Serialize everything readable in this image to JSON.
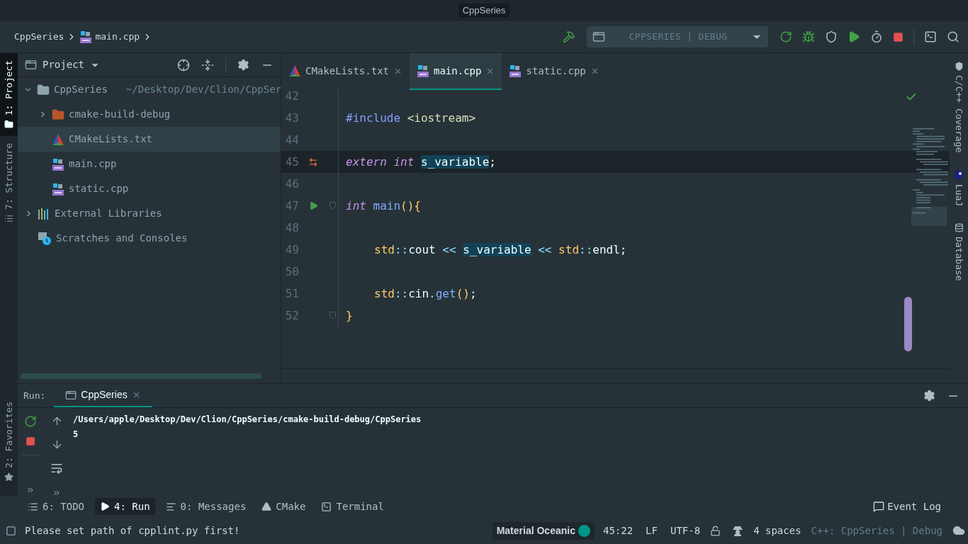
{
  "window": {
    "title": "CppSeries"
  },
  "breadcrumbs": [
    {
      "label": "CppSeries",
      "kind": "project"
    },
    {
      "label": "main.cpp",
      "kind": "cpp"
    }
  ],
  "run_config": {
    "label": "CPPSERIES | DEBUG"
  },
  "left_stripe": [
    {
      "label": "1: Project",
      "selected": true
    },
    {
      "label": "7: Structure",
      "selected": false
    }
  ],
  "left_stripe_bottom": [
    {
      "label": "2: Favorites",
      "selected": false
    }
  ],
  "project_panel": {
    "title": "Project",
    "tree": [
      {
        "label": "CppSeries",
        "path": "~/Desktop/Dev/Clion/CppSer",
        "kind": "folder",
        "expanded": true,
        "selected": false,
        "children": [
          {
            "label": "cmake-build-debug",
            "kind": "build-folder",
            "expanded": false,
            "selected": false
          },
          {
            "label": "CMakeLists.txt",
            "kind": "cmake",
            "selected": true
          },
          {
            "label": "main.cpp",
            "kind": "cpp",
            "selected": false
          },
          {
            "label": "static.cpp",
            "kind": "cpp",
            "selected": false
          }
        ]
      },
      {
        "label": "External Libraries",
        "kind": "libraries",
        "expanded": false,
        "selected": false
      },
      {
        "label": "Scratches and Consoles",
        "kind": "scratches",
        "selected": false
      }
    ]
  },
  "editor_tabs": [
    {
      "label": "CMakeLists.txt",
      "kind": "cmake",
      "selected": false
    },
    {
      "label": "main.cpp",
      "kind": "cpp",
      "selected": true
    },
    {
      "label": "static.cpp",
      "kind": "cpp",
      "selected": false
    }
  ],
  "code_lines": [
    {
      "number": "42",
      "current": false,
      "kind": "plain",
      "fold": false
    },
    {
      "number": "43",
      "current": false,
      "kind": "plain",
      "fold": false,
      "indented": false,
      "tokens": [
        {
          "text": "#include ",
          "kind": "preproc"
        },
        {
          "text": "<iostream>",
          "kind": "header"
        }
      ]
    },
    {
      "number": "44",
      "current": false,
      "kind": "plain",
      "fold": false
    },
    {
      "number": "45",
      "current": true,
      "kind": "override",
      "fold": false,
      "indented": false,
      "tokens": [
        {
          "text": "extern ",
          "kind": "keyword"
        },
        {
          "text": "int ",
          "kind": "keyword"
        },
        {
          "text": "s_variable",
          "kind": "highlight"
        },
        {
          "text": ";",
          "kind": "plain"
        }
      ]
    },
    {
      "number": "46",
      "current": false,
      "kind": "plain",
      "fold": false
    },
    {
      "number": "47",
      "current": false,
      "kind": "run",
      "fold": true,
      "indented": false,
      "tokens": [
        {
          "text": "int ",
          "kind": "keyword"
        },
        {
          "text": "main",
          "kind": "fn"
        },
        {
          "text": "(){",
          "kind": "brace"
        }
      ]
    },
    {
      "number": "48",
      "current": false,
      "kind": "plain",
      "fold": false
    },
    {
      "number": "49",
      "current": false,
      "kind": "plain",
      "fold": false,
      "indented": true,
      "tokens": [
        {
          "text": "std",
          "kind": "ns"
        },
        {
          "text": "::",
          "kind": "op"
        },
        {
          "text": "cout ",
          "kind": "plain"
        },
        {
          "text": "<< ",
          "kind": "op"
        },
        {
          "text": "s_variable",
          "kind": "highlight"
        },
        {
          "text": " << ",
          "kind": "op"
        },
        {
          "text": "std",
          "kind": "ns"
        },
        {
          "text": "::",
          "kind": "op"
        },
        {
          "text": "endl",
          "kind": "plain"
        },
        {
          "text": ";",
          "kind": "plain"
        }
      ]
    },
    {
      "number": "50",
      "current": false,
      "kind": "plain",
      "fold": false
    },
    {
      "number": "51",
      "current": false,
      "kind": "plain",
      "fold": false,
      "indented": true,
      "tokens": [
        {
          "text": "std",
          "kind": "ns"
        },
        {
          "text": "::",
          "kind": "op"
        },
        {
          "text": "cin",
          "kind": "plain"
        },
        {
          "text": ".",
          "kind": "op"
        },
        {
          "text": "get",
          "kind": "fn"
        },
        {
          "text": "()",
          "kind": "brace"
        },
        {
          "text": ";",
          "kind": "plain"
        }
      ]
    },
    {
      "number": "52",
      "current": false,
      "kind": "plain",
      "fold": true,
      "indented": false,
      "tokens": [
        {
          "text": "}",
          "kind": "brace"
        }
      ]
    }
  ],
  "right_stripe": [
    {
      "label": "C/C++ Coverage",
      "kind": "coverage"
    },
    {
      "label": "LuaJ",
      "kind": "luaj"
    },
    {
      "label": "Database",
      "kind": "database"
    }
  ],
  "run_panel": {
    "label": "Run:",
    "tabs": [
      {
        "label": "CppSeries",
        "selected": true
      }
    ],
    "output": [
      "/Users/apple/Desktop/Dev/Clion/CppSeries/cmake-build-debug/CppSeries",
      "5"
    ]
  },
  "tool_windows": [
    {
      "label": "6: TODO",
      "kind": "todo",
      "selected": false
    },
    {
      "label": "4: Run",
      "kind": "run",
      "selected": true
    },
    {
      "label": "0: Messages",
      "kind": "messages",
      "selected": false
    },
    {
      "label": "CMake",
      "kind": "cmake",
      "selected": false
    },
    {
      "label": "Terminal",
      "kind": "terminal",
      "selected": false
    }
  ],
  "event_log": {
    "label": "Event Log"
  },
  "status_bar": {
    "message": "Please set path of cpplint.py first!",
    "theme": "Material Oceanic",
    "position": "45:22",
    "line_separator": "LF",
    "encoding": "UTF-8",
    "indent": "4 spaces",
    "context": "C++: CppSeries | Debug"
  }
}
